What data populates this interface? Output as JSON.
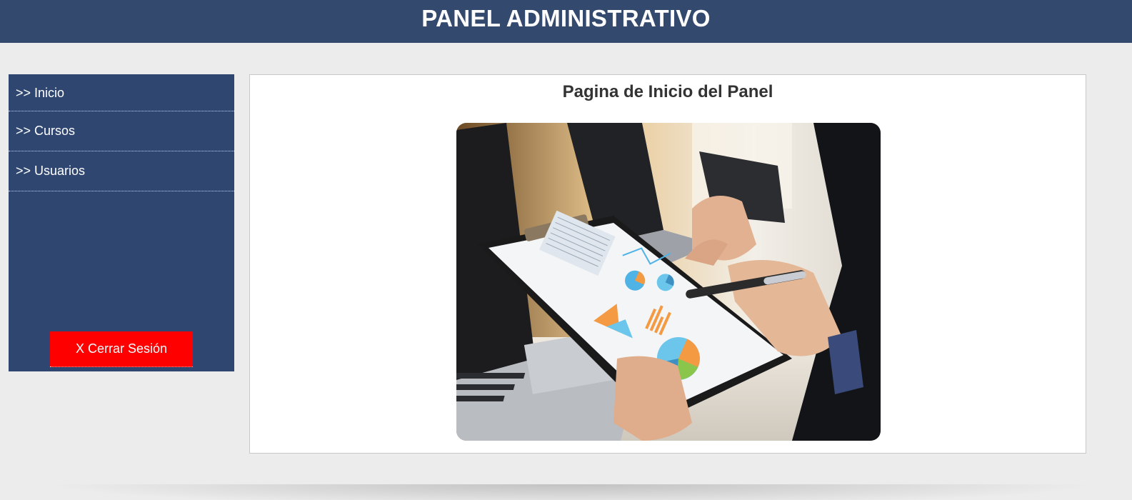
{
  "header": {
    "title": "PANEL ADMINISTRATIVO"
  },
  "sidebar": {
    "items": [
      {
        "label": ">> Inicio"
      },
      {
        "label": ">> Cursos"
      },
      {
        "label": ">> Usuarios"
      }
    ],
    "logout_label": "X Cerrar Sesión"
  },
  "main": {
    "title": "Pagina de Inicio del Panel",
    "image": {
      "icon": "business-analysis-photo"
    }
  },
  "colors": {
    "header_bg": "#33496e",
    "sidebar_bg": "#2f4770",
    "logout_bg": "#ff0000",
    "page_bg": "#ececec"
  }
}
